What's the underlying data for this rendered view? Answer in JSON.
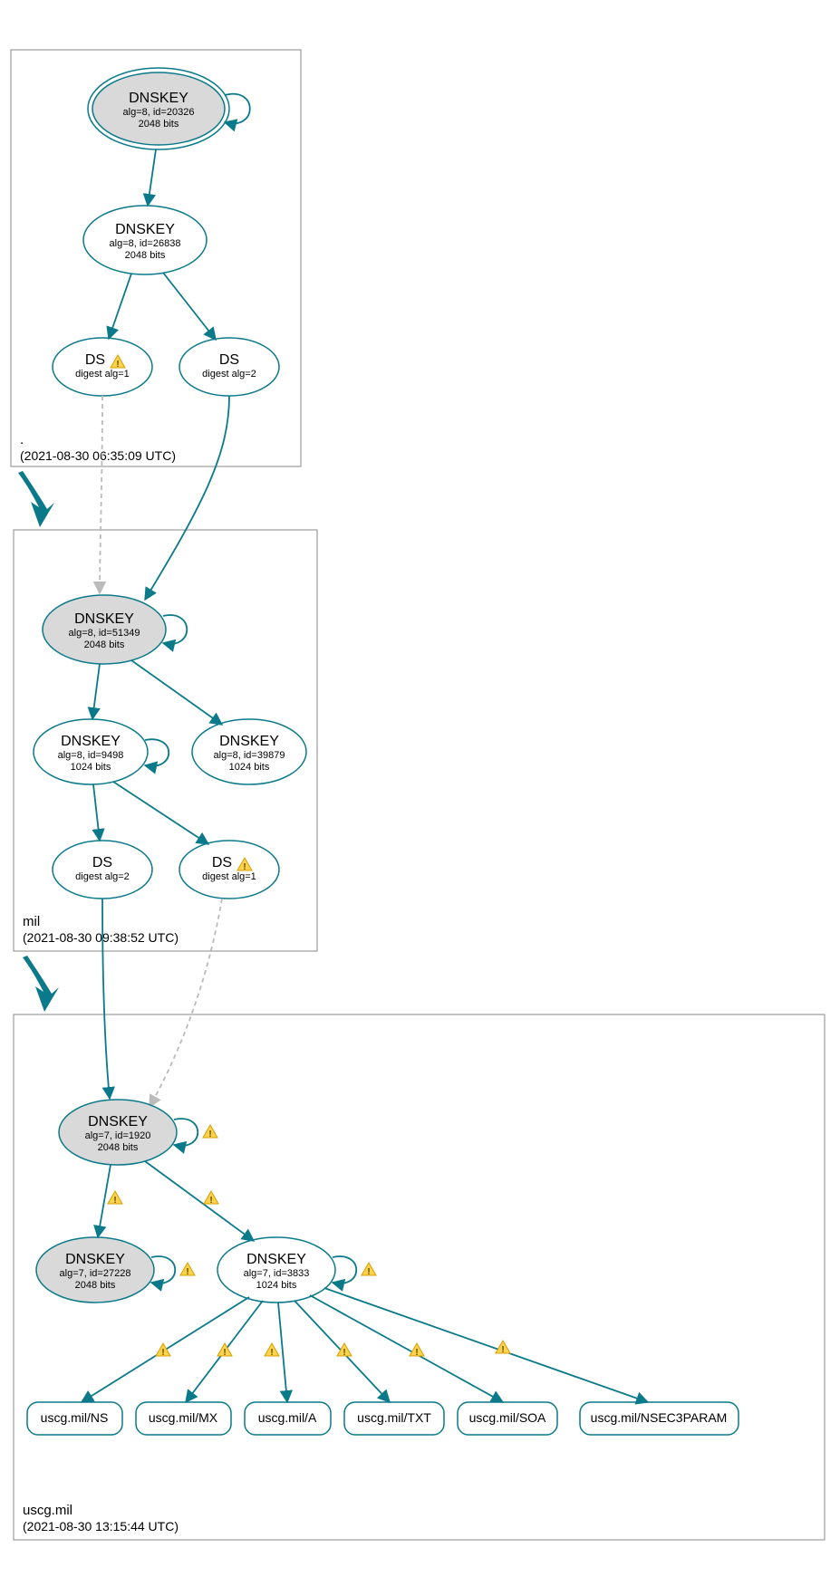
{
  "zones": {
    "root": {
      "name": ".",
      "timestamp": "(2021-08-30 06:35:09 UTC)"
    },
    "mil": {
      "name": "mil",
      "timestamp": "(2021-08-30 09:38:52 UTC)"
    },
    "uscg": {
      "name": "uscg.mil",
      "timestamp": "(2021-08-30 13:15:44 UTC)"
    }
  },
  "nodes": {
    "root_ksk": {
      "title": "DNSKEY",
      "line2": "alg=8, id=20326",
      "line3": "2048 bits"
    },
    "root_zsk": {
      "title": "DNSKEY",
      "line2": "alg=8, id=26838",
      "line3": "2048 bits"
    },
    "root_ds1": {
      "title": "DS",
      "line2": "digest alg=1"
    },
    "root_ds2": {
      "title": "DS",
      "line2": "digest alg=2"
    },
    "mil_ksk": {
      "title": "DNSKEY",
      "line2": "alg=8, id=51349",
      "line3": "2048 bits"
    },
    "mil_zsk1": {
      "title": "DNSKEY",
      "line2": "alg=8, id=9498",
      "line3": "1024 bits"
    },
    "mil_zsk2": {
      "title": "DNSKEY",
      "line2": "alg=8, id=39879",
      "line3": "1024 bits"
    },
    "mil_ds2": {
      "title": "DS",
      "line2": "digest alg=2"
    },
    "mil_ds1": {
      "title": "DS",
      "line2": "digest alg=1"
    },
    "uscg_ksk": {
      "title": "DNSKEY",
      "line2": "alg=7, id=1920",
      "line3": "2048 bits"
    },
    "uscg_k2": {
      "title": "DNSKEY",
      "line2": "alg=7, id=27228",
      "line3": "2048 bits"
    },
    "uscg_zsk": {
      "title": "DNSKEY",
      "line2": "alg=7, id=3833",
      "line3": "1024 bits"
    },
    "rr_ns": {
      "label": "uscg.mil/NS"
    },
    "rr_mx": {
      "label": "uscg.mil/MX"
    },
    "rr_a": {
      "label": "uscg.mil/A"
    },
    "rr_txt": {
      "label": "uscg.mil/TXT"
    },
    "rr_soa": {
      "label": "uscg.mil/SOA"
    },
    "rr_nsec3": {
      "label": "uscg.mil/NSEC3PARAM"
    }
  },
  "chart_data": {
    "type": "dnssec-authentication-graph",
    "zones": [
      {
        "name": ".",
        "analyzed_at": "2021-08-30 06:35:09 UTC"
      },
      {
        "name": "mil",
        "analyzed_at": "2021-08-30 09:38:52 UTC"
      },
      {
        "name": "uscg.mil",
        "analyzed_at": "2021-08-30 13:15:44 UTC"
      }
    ],
    "keys": [
      {
        "id": "root_ksk",
        "zone": ".",
        "type": "DNSKEY",
        "alg": 8,
        "key_id": 20326,
        "bits": 2048,
        "role": "KSK",
        "trust_anchor": true
      },
      {
        "id": "root_zsk",
        "zone": ".",
        "type": "DNSKEY",
        "alg": 8,
        "key_id": 26838,
        "bits": 2048,
        "role": "ZSK"
      },
      {
        "id": "mil_ksk",
        "zone": "mil",
        "type": "DNSKEY",
        "alg": 8,
        "key_id": 51349,
        "bits": 2048,
        "role": "KSK"
      },
      {
        "id": "mil_zsk1",
        "zone": "mil",
        "type": "DNSKEY",
        "alg": 8,
        "key_id": 9498,
        "bits": 1024,
        "role": "ZSK"
      },
      {
        "id": "mil_zsk2",
        "zone": "mil",
        "type": "DNSKEY",
        "alg": 8,
        "key_id": 39879,
        "bits": 1024,
        "role": "ZSK"
      },
      {
        "id": "uscg_ksk",
        "zone": "uscg.mil",
        "type": "DNSKEY",
        "alg": 7,
        "key_id": 1920,
        "bits": 2048,
        "role": "KSK"
      },
      {
        "id": "uscg_k2",
        "zone": "uscg.mil",
        "type": "DNSKEY",
        "alg": 7,
        "key_id": 27228,
        "bits": 2048,
        "role": "KSK"
      },
      {
        "id": "uscg_zsk",
        "zone": "uscg.mil",
        "type": "DNSKEY",
        "alg": 7,
        "key_id": 3833,
        "bits": 1024,
        "role": "ZSK"
      }
    ],
    "ds_records": [
      {
        "id": "root_ds1",
        "parent_zone": ".",
        "child_zone": "mil",
        "digest_alg": 1,
        "warning": true
      },
      {
        "id": "root_ds2",
        "parent_zone": ".",
        "child_zone": "mil",
        "digest_alg": 2
      },
      {
        "id": "mil_ds2",
        "parent_zone": "mil",
        "child_zone": "uscg.mil",
        "digest_alg": 2
      },
      {
        "id": "mil_ds1",
        "parent_zone": "mil",
        "child_zone": "uscg.mil",
        "digest_alg": 1,
        "warning": true
      }
    ],
    "rrsets": [
      {
        "id": "rr_ns",
        "name": "uscg.mil",
        "type": "NS"
      },
      {
        "id": "rr_mx",
        "name": "uscg.mil",
        "type": "MX"
      },
      {
        "id": "rr_a",
        "name": "uscg.mil",
        "type": "A"
      },
      {
        "id": "rr_txt",
        "name": "uscg.mil",
        "type": "TXT"
      },
      {
        "id": "rr_soa",
        "name": "uscg.mil",
        "type": "SOA"
      },
      {
        "id": "rr_nsec3",
        "name": "uscg.mil",
        "type": "NSEC3PARAM"
      }
    ],
    "edges": [
      {
        "from": "root_ksk",
        "to": "root_ksk",
        "style": "self",
        "secure": true
      },
      {
        "from": "root_ksk",
        "to": "root_zsk",
        "secure": true
      },
      {
        "from": "root_zsk",
        "to": "root_ds1",
        "secure": true
      },
      {
        "from": "root_zsk",
        "to": "root_ds2",
        "secure": true
      },
      {
        "from": "root_ds1",
        "to": "mil_ksk",
        "secure": false,
        "style": "dashed"
      },
      {
        "from": "root_ds2",
        "to": "mil_ksk",
        "secure": true
      },
      {
        "from": "mil_ksk",
        "to": "mil_ksk",
        "style": "self",
        "secure": true
      },
      {
        "from": "mil_ksk",
        "to": "mil_zsk1",
        "secure": true
      },
      {
        "from": "mil_ksk",
        "to": "mil_zsk2",
        "secure": true
      },
      {
        "from": "mil_zsk1",
        "to": "mil_zsk1",
        "style": "self",
        "secure": true
      },
      {
        "from": "mil_zsk1",
        "to": "mil_ds2",
        "secure": true
      },
      {
        "from": "mil_zsk1",
        "to": "mil_ds1",
        "secure": true
      },
      {
        "from": "mil_ds2",
        "to": "uscg_ksk",
        "secure": true
      },
      {
        "from": "mil_ds1",
        "to": "uscg_ksk",
        "secure": false,
        "style": "dashed"
      },
      {
        "from": "uscg_ksk",
        "to": "uscg_ksk",
        "style": "self",
        "secure": true,
        "warning": true
      },
      {
        "from": "uscg_ksk",
        "to": "uscg_k2",
        "secure": true,
        "warning": true
      },
      {
        "from": "uscg_ksk",
        "to": "uscg_zsk",
        "secure": true,
        "warning": true
      },
      {
        "from": "uscg_k2",
        "to": "uscg_k2",
        "style": "self",
        "secure": true,
        "warning": true
      },
      {
        "from": "uscg_zsk",
        "to": "uscg_zsk",
        "style": "self",
        "secure": true,
        "warning": true
      },
      {
        "from": "uscg_zsk",
        "to": "rr_ns",
        "secure": true,
        "warning": true
      },
      {
        "from": "uscg_zsk",
        "to": "rr_mx",
        "secure": true,
        "warning": true
      },
      {
        "from": "uscg_zsk",
        "to": "rr_a",
        "secure": true,
        "warning": true
      },
      {
        "from": "uscg_zsk",
        "to": "rr_txt",
        "secure": true,
        "warning": true
      },
      {
        "from": "uscg_zsk",
        "to": "rr_soa",
        "secure": true,
        "warning": true
      },
      {
        "from": "uscg_zsk",
        "to": "rr_nsec3",
        "secure": true,
        "warning": true
      }
    ]
  }
}
